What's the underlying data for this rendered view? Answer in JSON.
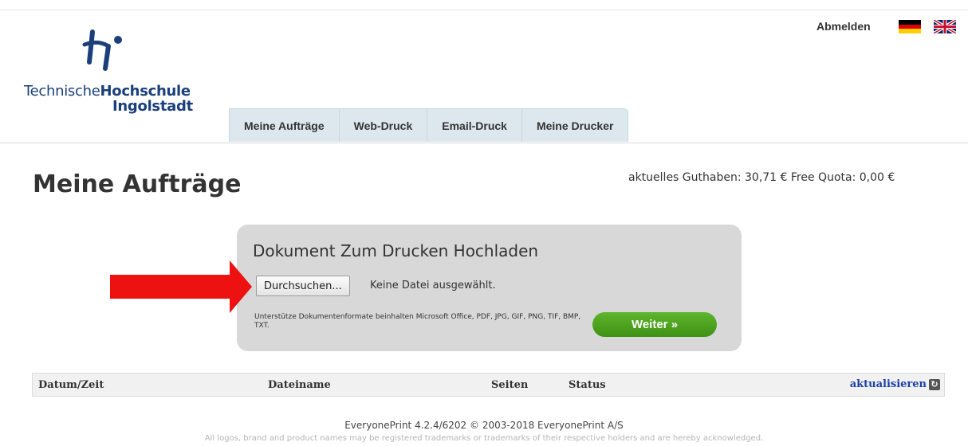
{
  "header": {
    "logo": {
      "line1_regular": "Technische",
      "line1_bold": "Hochschule",
      "line2": "Ingolstadt",
      "color": "#1b3f7a"
    },
    "logout_label": "Abmelden",
    "languages": [
      {
        "name": "de-flag-icon"
      },
      {
        "name": "uk-flag-icon"
      }
    ]
  },
  "nav": {
    "tabs": [
      {
        "label": "Meine Aufträge"
      },
      {
        "label": "Web-Druck"
      },
      {
        "label": "Email-Druck"
      },
      {
        "label": "Meine Drucker"
      }
    ]
  },
  "main": {
    "title": "Meine Aufträge",
    "balance": "aktuelles Guthaben:  30,71 € Free Quota: 0,00 €"
  },
  "upload": {
    "title": "Dokument Zum Drucken Hochladen",
    "browse_label": "Durchsuchen...",
    "no_file_text": "Keine Datei ausgewählt.",
    "formats_text": "Unterstütze Dokumentenformate beinhalten Microsoft Office, PDF, JPG, GIF, PNG, TIF, BMP, TXT.",
    "next_label": "Weiter »",
    "accent": "#4ea620"
  },
  "jobs_table": {
    "columns": [
      "Datum/Zeit",
      "Dateiname",
      "Seiten",
      "Status"
    ],
    "refresh_label": "aktualisieren"
  },
  "annotation": {
    "arrow_color": "#ee1111"
  },
  "footer": {
    "version": "EveryonePrint 4.2.4/6202 © 2003-2018 EveryonePrint A/S",
    "disclaimer": "All logos, brand and product names may be registered trademarks or trademarks of their respective holders and are hereby acknowledged."
  }
}
